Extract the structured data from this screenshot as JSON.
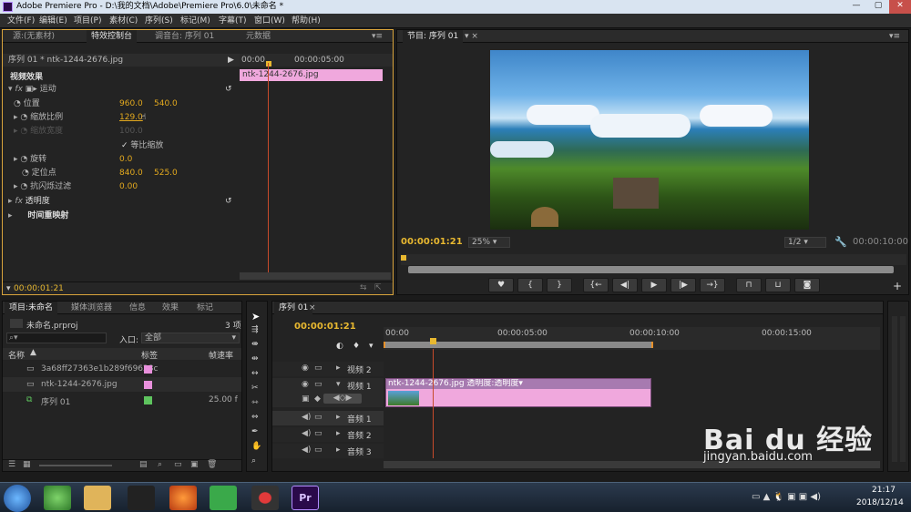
{
  "window": {
    "title": "Adobe Premiere Pro - D:\\我的文档\\Adobe\\Premiere Pro\\6.0\\未命名 *"
  },
  "menu": [
    "文件(F)",
    "编辑(E)",
    "项目(P)",
    "素材(C)",
    "序列(S)",
    "标记(M)",
    "字幕(T)",
    "窗口(W)",
    "帮助(H)"
  ],
  "effect_panel": {
    "tabs": [
      "源:(无素材)",
      "特效控制台",
      "调音台: 序列 01",
      "元数据"
    ],
    "clip_title": "序列 01 * ntk-1244-2676.jpg",
    "ruler_start": "00:00",
    "ruler_mid": "00:00:05:00",
    "clip_bar": "ntk-1244-2676.jpg",
    "section": "视频效果",
    "motion": "运动",
    "rows": [
      {
        "label": "位置",
        "v1": "960.0",
        "v2": "540.0"
      },
      {
        "label": "缩放比例",
        "v1": "129.0",
        "v2": ""
      },
      {
        "label": "缩放宽度",
        "v1": "100.0",
        "v2": ""
      },
      {
        "label": "旋转",
        "v1": "0.0",
        "v2": ""
      },
      {
        "label": "定位点",
        "v1": "840.0",
        "v2": "525.0"
      },
      {
        "label": "抗闪烁过滤",
        "v1": "0.00",
        "v2": ""
      }
    ],
    "uniform_scale": "等比缩放",
    "opacity": "透明度",
    "time_remap": "时间重映射",
    "timecode": "00:00:01:21"
  },
  "program": {
    "tab": "节目: 序列 01",
    "timecode": "00:00:01:21",
    "zoom": "25%",
    "quality": "1/2",
    "duration": "00:00:10:00"
  },
  "project": {
    "tabs": [
      "项目:未命名",
      "媒体浏览器",
      "信息",
      "效果",
      "标记"
    ],
    "file": "未命名.prproj",
    "count": "3 项",
    "in_label": "入口:",
    "in_value": "全部",
    "col_name": "名称",
    "col_label": "标签",
    "col_rate": "帧速率",
    "items": [
      {
        "name": "3a68ff27363e1b289f69628c",
        "rate": "",
        "color": "#e890dc"
      },
      {
        "name": "ntk-1244-2676.jpg",
        "rate": "",
        "color": "#e890dc"
      },
      {
        "name": "序列 01",
        "rate": "25.00 f",
        "color": "#5ec45e"
      }
    ]
  },
  "timeline": {
    "tab": "序列 01",
    "timecode": "00:00:01:21",
    "ruler": [
      "00:00",
      "00:00:05:00",
      "00:00:10:00",
      "00:00:15:00"
    ],
    "tracks": [
      "视频 2",
      "视频 1",
      "音频 1",
      "音频 2",
      "音频 3"
    ],
    "clip": "ntk-1244-2676.jpg  透明度:透明度▾"
  },
  "taskbar": {
    "time": "21:17",
    "date": "2018/12/14"
  },
  "watermark": {
    "brand": "Bai du 经验",
    "url": "jingyan.baidu.com"
  }
}
